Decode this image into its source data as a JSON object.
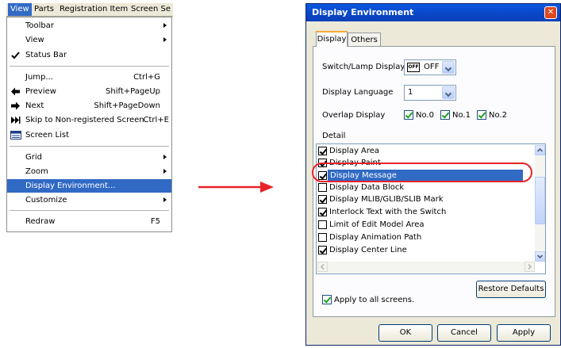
{
  "menubar": {
    "items": [
      "View",
      "Parts",
      "Registration Item",
      "Screen Se"
    ]
  },
  "menu": {
    "items": [
      {
        "label": "Toolbar",
        "submenu": true
      },
      {
        "label": "View",
        "submenu": true
      },
      {
        "label": "Status Bar",
        "checked": true
      },
      {
        "label": "Jump...",
        "shortcut": "Ctrl+G"
      },
      {
        "label": "Preview",
        "shortcut": "Shift+PageUp",
        "icon": "left-arrow-icon"
      },
      {
        "label": "Next",
        "shortcut": "Shift+PageDown",
        "icon": "right-arrow-icon"
      },
      {
        "label": "Skip to Non-registered Screen",
        "shortcut": "Ctrl+E",
        "icon": "skip-icon"
      },
      {
        "label": "Screen List",
        "icon": "screen-list-icon"
      },
      {
        "label": "Grid",
        "submenu": true
      },
      {
        "label": "Zoom",
        "submenu": true
      },
      {
        "label": "Display Environment...",
        "highlighted": true
      },
      {
        "label": "Customize",
        "submenu": true
      },
      {
        "label": "Redraw",
        "shortcut": "F5"
      }
    ]
  },
  "dialog": {
    "title": "Display Environment",
    "close": "✕",
    "tabs": [
      "Display",
      "Others"
    ],
    "switch_lamp_label": "Switch/Lamp Display",
    "switch_lamp_icon_text": "OFF",
    "switch_lamp_value": "OFF",
    "language_label": "Display Language",
    "language_value": "1",
    "overlap_label": "Overlap Display",
    "overlap": [
      {
        "label": "No.0",
        "checked": true
      },
      {
        "label": "No.1",
        "checked": true
      },
      {
        "label": "No.2",
        "checked": true
      }
    ],
    "detail_label": "Detail",
    "detail_items": [
      {
        "label": "Display Area",
        "checked": true
      },
      {
        "label": "Display Paint",
        "checked": true
      },
      {
        "label": "Display Message",
        "checked": true,
        "selected": true
      },
      {
        "label": "Display Data Block",
        "checked": false
      },
      {
        "label": "Display MLIB/GLIB/SLIB Mark",
        "checked": true
      },
      {
        "label": "Interlock Text with the Switch",
        "checked": true
      },
      {
        "label": "Limit of Edit Model Area",
        "checked": false
      },
      {
        "label": "Display Animation Path",
        "checked": false
      },
      {
        "label": "Display Center Line",
        "checked": true
      }
    ],
    "restore_defaults": "Restore Defaults",
    "apply_all_label": "Apply to all screens.",
    "apply_all_checked": true,
    "ok": "OK",
    "cancel": "Cancel",
    "apply": "Apply"
  },
  "colors": {
    "highlight": "#316ac5",
    "annotation": "#e8242a",
    "title_bar": "#0a46c6"
  }
}
